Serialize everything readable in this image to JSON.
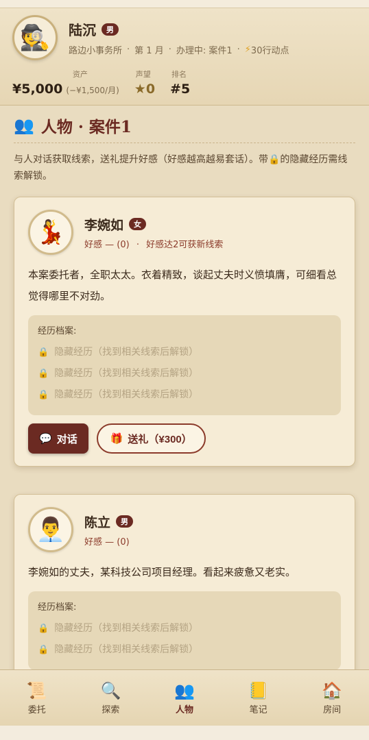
{
  "player": {
    "name": "陆沉",
    "gender": "男",
    "office": "路边小事务所",
    "month": "第 1 月",
    "case_status": "办理中: 案件1",
    "action_points": "30行动点",
    "stats": {
      "assets_label": "资产",
      "assets_value": "¥5,000",
      "assets_change": "(−¥1,500/月)",
      "reputation_label": "声望",
      "reputation_value": "★0",
      "rank_label": "排名",
      "rank_value": "#5"
    }
  },
  "section": {
    "title": "人物 · 案件1",
    "intro": "与人对话获取线索，送礼提升好感（好感越高越易套话）。带🔒的隐藏经历需线索解锁。"
  },
  "characters": [
    {
      "name": "李婉如",
      "gender": "女",
      "favor": "好感 — (0)",
      "favor_hint": "好感达2可获新线索",
      "description": "本案委托者，全职太太。衣着精致，谈起丈夫时义愤填膺，可细看总觉得哪里不对劲。",
      "history_title": "经历档案:",
      "history": [
        "隐藏经历（找到相关线索后解锁）",
        "隐藏经历（找到相关线索后解锁）",
        "隐藏经历（找到相关线索后解锁）"
      ],
      "talk_label": "对话",
      "gift_label": "送礼（¥300）",
      "avatar_icon": "dancer-icon"
    },
    {
      "name": "陈立",
      "gender": "男",
      "favor": "好感 — (0)",
      "description": "李婉如的丈夫，某科技公司项目经理。看起来疲惫又老实。",
      "history_title": "经历档案:",
      "history": [
        "隐藏经历（找到相关线索后解锁）",
        "隐藏经历（找到相关线索后解锁）"
      ],
      "avatar_icon": "office-worker-icon"
    }
  ],
  "nav": [
    {
      "label": "委托",
      "icon": "scroll-icon"
    },
    {
      "label": "探索",
      "icon": "magnifier-icon"
    },
    {
      "label": "人物",
      "icon": "people-icon",
      "active": true
    },
    {
      "label": "笔记",
      "icon": "notebook-icon"
    },
    {
      "label": "房间",
      "icon": "house-icon"
    }
  ],
  "colors": {
    "accent": "#6b2a22",
    "background": "#e9dcc0",
    "card": "#f6ecd6"
  }
}
